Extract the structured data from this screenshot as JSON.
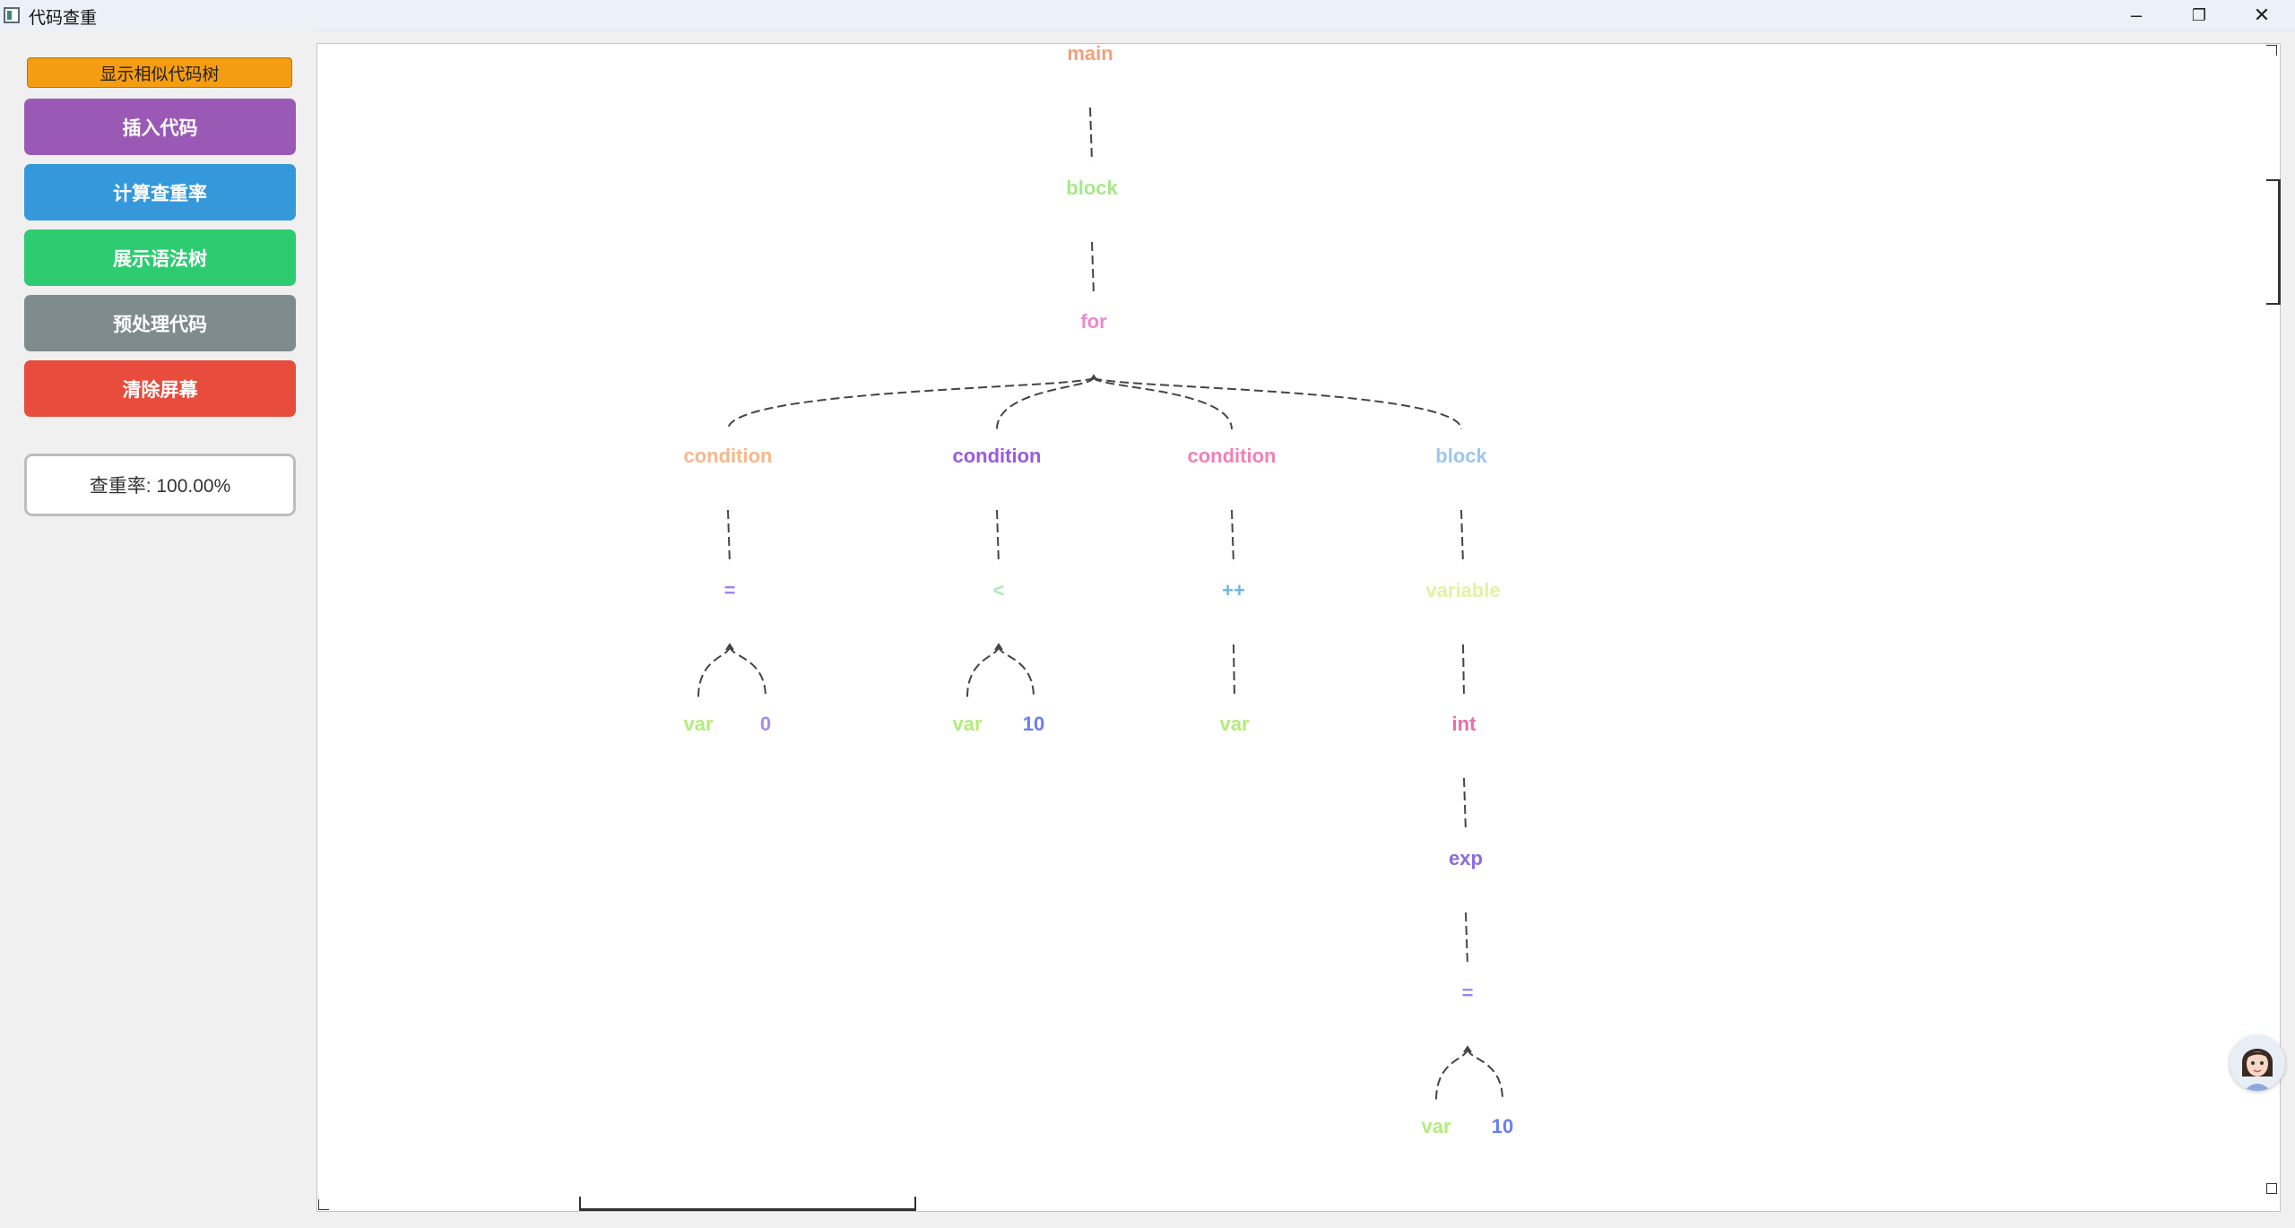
{
  "window": {
    "title": "代码查重",
    "controls": {
      "minimize": "–",
      "restore": "❐",
      "close": "✕"
    }
  },
  "sidebar": {
    "similar_tree_label": "显示相似代码树",
    "buttons": [
      {
        "label": "插入代码",
        "color": "#9b59b6"
      },
      {
        "label": "计算查重率",
        "color": "#3498db"
      },
      {
        "label": "展示语法树",
        "color": "#2ecc71"
      },
      {
        "label": "预处理代码",
        "color": "#7f8c8d"
      },
      {
        "label": "清除屏幕",
        "color": "#e74c3c"
      }
    ],
    "rate_text": "查重率: 100.00%"
  },
  "tree": {
    "nodes": [
      {
        "id": "main",
        "label": "main",
        "color": "#f3a07a",
        "parent": null
      },
      {
        "id": "block1",
        "label": "block",
        "color": "#a6e88a",
        "parent": "main"
      },
      {
        "id": "for",
        "label": "for",
        "color": "#ee88cc",
        "parent": "block1"
      },
      {
        "id": "cond1",
        "label": "condition",
        "color": "#f7b88a",
        "parent": "for"
      },
      {
        "id": "cond2",
        "label": "condition",
        "color": "#9b5ae0",
        "parent": "for"
      },
      {
        "id": "cond3",
        "label": "condition",
        "color": "#f080b8",
        "parent": "for"
      },
      {
        "id": "block2",
        "label": "block",
        "color": "#9ec6f0",
        "parent": "for"
      },
      {
        "id": "eq1",
        "label": "=",
        "color": "#9a88ee",
        "parent": "cond1"
      },
      {
        "id": "lt",
        "label": "<",
        "color": "#a6ecb8",
        "parent": "cond2"
      },
      {
        "id": "inc",
        "label": "++",
        "color": "#6ab8dc",
        "parent": "cond3"
      },
      {
        "id": "variable",
        "label": "variable",
        "color": "#def59e",
        "parent": "block2"
      },
      {
        "id": "var1",
        "label": "var",
        "color": "#b4ec7a",
        "parent": "eq1"
      },
      {
        "id": "zero",
        "label": "0",
        "color": "#a68cf0",
        "parent": "eq1"
      },
      {
        "id": "var2",
        "label": "var",
        "color": "#b4ec7a",
        "parent": "lt"
      },
      {
        "id": "ten1",
        "label": "10",
        "color": "#6a7ef0",
        "parent": "lt"
      },
      {
        "id": "var3",
        "label": "var",
        "color": "#b4ec7a",
        "parent": "inc"
      },
      {
        "id": "int",
        "label": "int",
        "color": "#ee6aa8",
        "parent": "variable"
      },
      {
        "id": "exp",
        "label": "exp",
        "color": "#8a6ae0",
        "parent": "int"
      },
      {
        "id": "eq2",
        "label": "=",
        "color": "#9a88ee",
        "parent": "exp"
      },
      {
        "id": "var4",
        "label": "var",
        "color": "#b4ec7a",
        "parent": "eq2"
      },
      {
        "id": "ten2",
        "label": "10",
        "color": "#6a7ef0",
        "parent": "eq2"
      }
    ]
  }
}
